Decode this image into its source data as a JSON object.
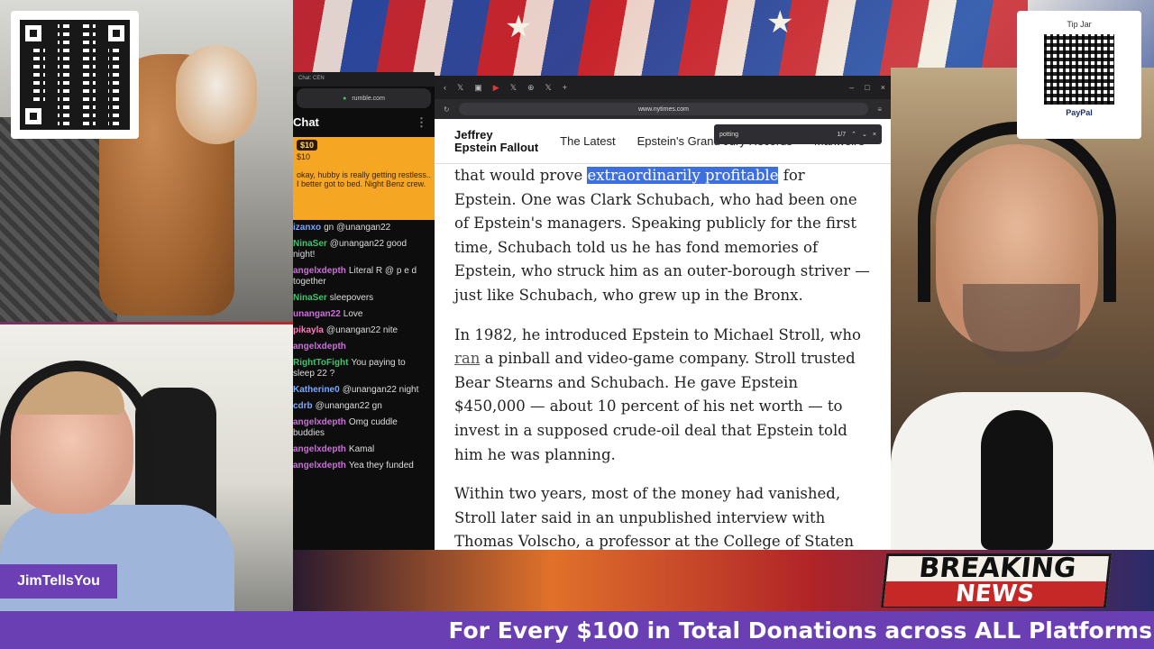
{
  "overlay": {
    "name_tag": "JimTellsYou",
    "tip_jar_title": "Tip Jar",
    "tip_jar_provider": "PayPal",
    "ticker": "For Every $100 in Total Donations across ALL Platforms",
    "breaking_line1": "BREAKING",
    "breaking_line2": "NEWS"
  },
  "chat": {
    "window_title": "Chat: CEN",
    "url": "rumble.com",
    "heading": "Chat",
    "rant": {
      "amount": "$10",
      "amount_sub": "$10",
      "text": "okay, hubby is really getting restless.. I better got to bed. Night Benz crew."
    },
    "messages": [
      {
        "user": "izanxo",
        "color": "#7aa7ff",
        "text": "gn @unangan22"
      },
      {
        "user": "NinaSer",
        "color": "#3ec46d",
        "text": "@unangan22 good night!"
      },
      {
        "user": "angelxdepth",
        "color": "#d06be0",
        "text": "Literal R @ p e d together"
      },
      {
        "user": "NinaSer",
        "color": "#3ec46d",
        "text": "sleepovers"
      },
      {
        "user": "unangan22",
        "color": "#d06be0",
        "text": "Love"
      },
      {
        "user": "pikayla",
        "color": "#ff7ab8",
        "text": "@unangan22 nite"
      },
      {
        "user": "angelxdepth",
        "color": "#d06be0",
        "text": ""
      },
      {
        "user": "RightToFight",
        "color": "#3ec46d",
        "text": "You paying to sleep 22 ?"
      },
      {
        "user": "Katherine0",
        "color": "#7aa7ff",
        "text": "@unangan22 night"
      },
      {
        "user": "cdrb",
        "color": "#7aa7ff",
        "text": "@unangan22 gn"
      },
      {
        "user": "angelxdepth",
        "color": "#d06be0",
        "text": "Omg cuddle buddies"
      },
      {
        "user": "angelxdepth",
        "color": "#d06be0",
        "text": "Kamal"
      },
      {
        "user": "angelxdepth",
        "color": "#d06be0",
        "text": "Yea they funded"
      }
    ]
  },
  "browser": {
    "url": "www.nytimes.com",
    "find_query": "potting",
    "find_count": "1/7",
    "site_logo_line1": "Jeffrey",
    "site_logo_line2": "Epstein Fallout",
    "nav": [
      "The Latest",
      "Epstein's Grand Jury Records",
      "Maxwell's"
    ],
    "article": {
      "p1_pre": "that would prove ",
      "p1_hl": "extraordinarily profitable",
      "p1_post": " for Epstein. One was Clark Schubach, who had been one of Epstein's managers. Speaking publicly for the first time, Schubach told us he has fond memories of Epstein, who struck him as an outer-borough striver — just like Schubach, who grew up in the Bronx.",
      "p2_pre": "In 1982, he introduced Epstein to Michael Stroll, who ",
      "p2_link": "ran",
      "p2_post": " a pinball and video-game company. Stroll trusted Bear Stearns and Schubach. He gave Epstein $450,000 — about 10 percent of his net worth — to invest in a supposed crude-oil deal that Epstein told him he was planning.",
      "p3": "Within two years, most of the money had vanished, Stroll later said in an unpublished interview with Thomas Volscho, a professor at the College of Staten"
    }
  }
}
